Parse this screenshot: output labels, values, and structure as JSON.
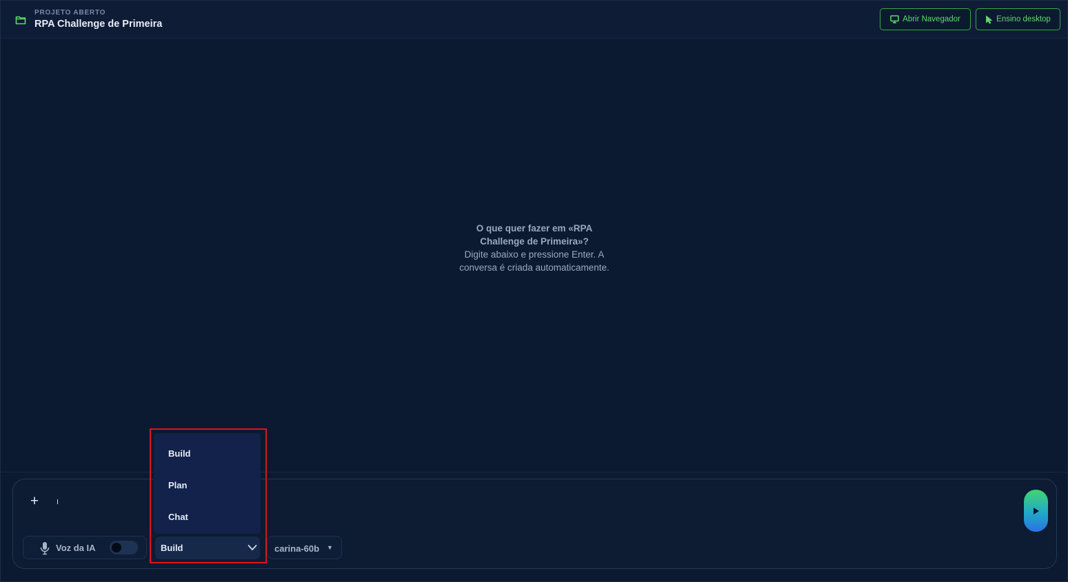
{
  "header": {
    "project_label": "PROJETO ABERTO",
    "project_title": "RPA Challenge de Primeira",
    "buttons": {
      "open_browser": "Abrir Navegador",
      "desktop_teaching": "Ensino desktop"
    }
  },
  "main": {
    "empty_state": {
      "question": "O que quer fazer em «RPA Challenge de Primeira»?",
      "hint": "Digite abaixo e pressione Enter. A conversa é criada automaticamente."
    }
  },
  "composer": {
    "add_button": "+",
    "voice": {
      "label": "Voz da IA",
      "enabled": false
    },
    "mode_select": {
      "selected": "Build",
      "options": [
        "Build",
        "Plan",
        "Chat"
      ],
      "open": true
    },
    "model_select": {
      "selected": "carina-60b",
      "arrow": "▼"
    }
  },
  "colors": {
    "background": "#0b1a30",
    "accent_green": "#5fd96d",
    "highlight_red": "#e0131b"
  },
  "icons": [
    "folder-icon",
    "monitor-icon",
    "cursor-icon",
    "mic-icon",
    "chevron-down-icon",
    "play-icon"
  ]
}
